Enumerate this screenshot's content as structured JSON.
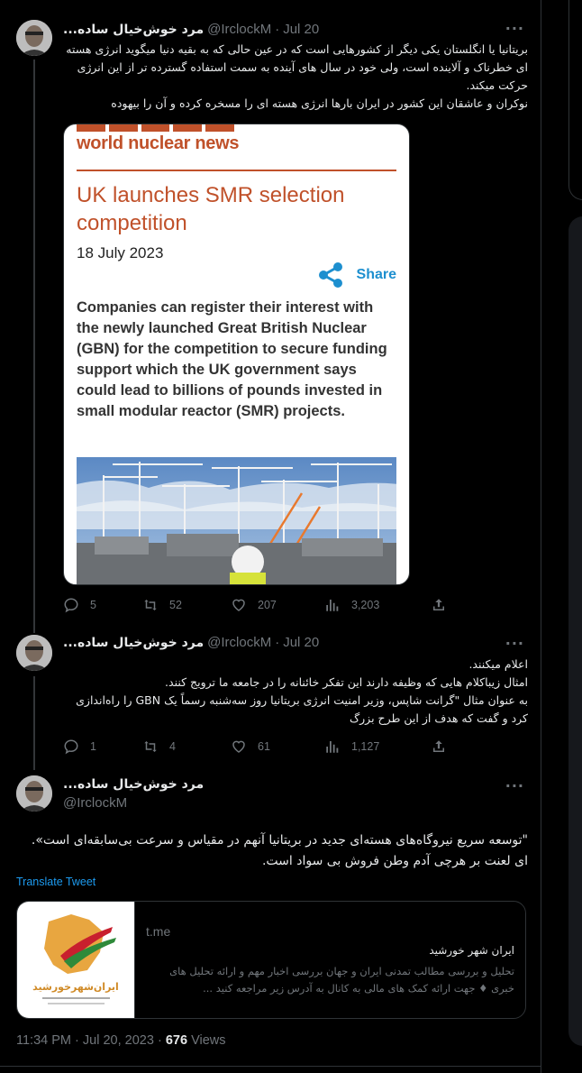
{
  "tweets": [
    {
      "name": "مرد خوش‌خیال ساده...",
      "handle": "@IrclockM",
      "dot": "·",
      "date": "Jul 20",
      "more": "···",
      "text": [
        "بریتانیا یا انگلستان یکی دیگر از کشورهایی است که در عین حالی که به بقیه دنیا میگوید انرژی هسته ای خطرناک و آلاینده است، ولی خود در سال های آینده به سمت استفاده گسترده تر از این انرژی حرکت میکند.",
        "نوکران و عاشقان این کشور در ایران بارها انرژی هسته ای را مسخره کرده و آن را بیهوده"
      ],
      "stats": {
        "replies": "5",
        "retweets": "52",
        "likes": "207",
        "views": "3,203"
      }
    },
    {
      "name": "مرد خوش‌خیال ساده...",
      "handle": "@IrclockM",
      "dot": "·",
      "date": "Jul 20",
      "more": "···",
      "text": [
        "اعلام میکنند.",
        "امثال زیباکلام هایی که وظیفه دارند این تفکر خائنانه را در جامعه ما ترویج کنند.",
        "به عنوان مثال \"گرانت شاپس، وزیر امنیت انرژی بریتانیا روز سه‌شنبه رسماً یک GBN را راه‌اندازی کرد و گفت که هدف از این طرح بزرگ"
      ],
      "stats": {
        "replies": "1",
        "retweets": "4",
        "likes": "61",
        "views": "1,127"
      }
    }
  ],
  "embed": {
    "brand": "world nuclear news",
    "title": "UK launches SMR selection competition",
    "date": "18 July 2023",
    "share": "Share",
    "body": "Companies can register their interest with the newly launched Great British Nuclear (GBN) for the competition to secure funding support which the UK government says could lead to billions of pounds invested in small modular reactor (SMR) projects."
  },
  "main_tweet": {
    "name": "مرد خوش‌خیال ساده...",
    "handle": "@IrclockM",
    "more": "···",
    "line1": "\"توسعه سریع نیروگاه‌های هسته‌ای جدید در بریتانیا آنهم در مقیاس و سرعت بی‌سابقه‌ای است».",
    "line2": "ای لعنت بر هرچی آدم وطن فروش بی سواد است.",
    "translate": "Translate Tweet",
    "link_card": {
      "domain": "t.me",
      "title": "ایران شهر خورشید",
      "description": "تحلیل و بررسی مطالب تمدنی ایران و جهان بررسی اخبار مهم و ارائه تحلیل های خبری ♦ جهت ارائه کمک های مالی به کانال به آدرس زیر مراجعه کنید ...",
      "thumb_text": "ایران‌شهرخورشید"
    },
    "time": "11:34 PM",
    "date": "Jul 20, 2023",
    "dot": "·",
    "views_count": "676",
    "views_label": "Views"
  }
}
